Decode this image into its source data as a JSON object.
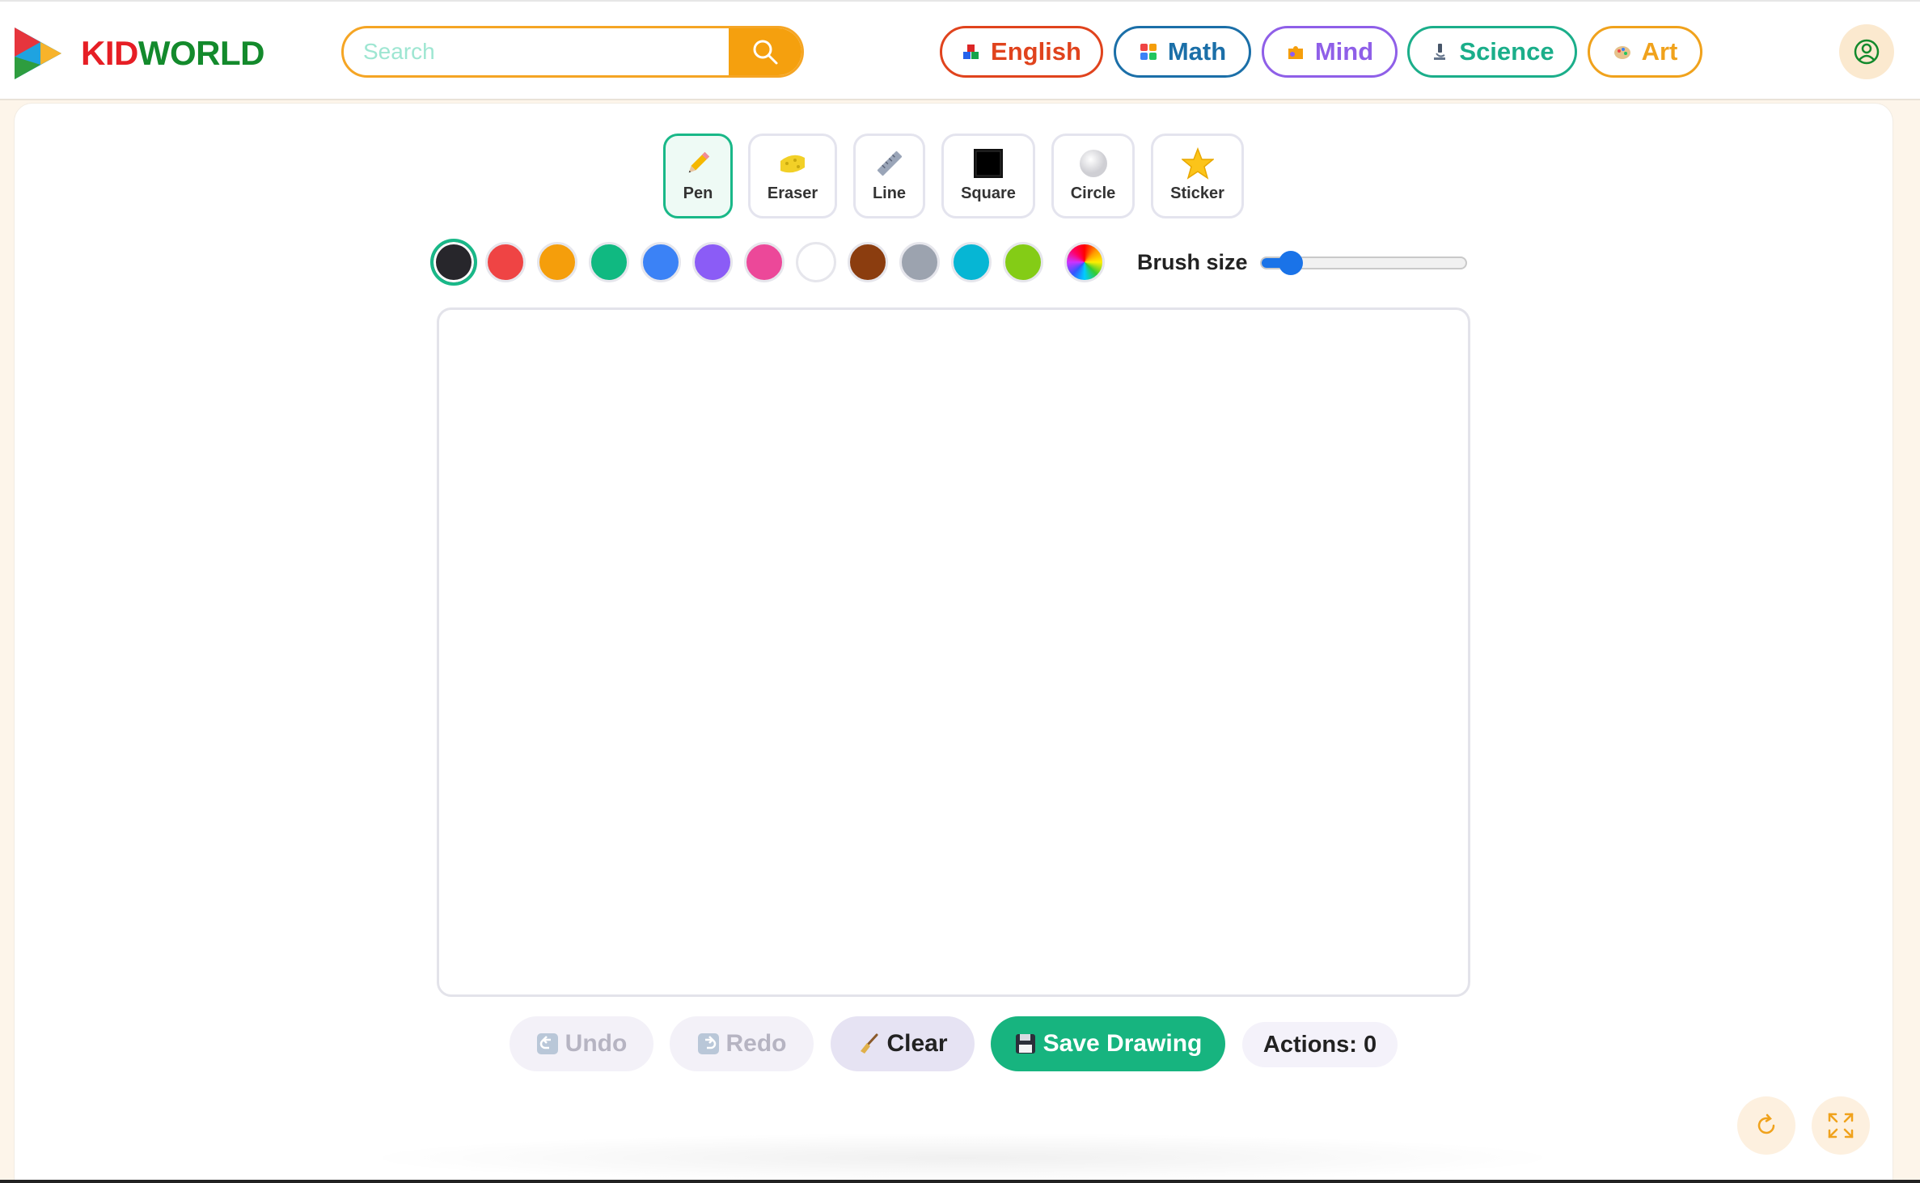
{
  "header": {
    "brand_part1": "KID",
    "brand_part2": "WORLD",
    "search_placeholder": "Search",
    "nav": [
      {
        "label": "English",
        "color": "#e0431d"
      },
      {
        "label": "Math",
        "color": "#1b6fa8"
      },
      {
        "label": "Mind",
        "color": "#8f5fe8"
      },
      {
        "label": "Science",
        "color": "#1bae8a"
      },
      {
        "label": "Art",
        "color": "#f0a21c"
      }
    ]
  },
  "tools": [
    {
      "label": "Pen",
      "icon": "pencil-icon",
      "active": true
    },
    {
      "label": "Eraser",
      "icon": "sponge-icon",
      "active": false
    },
    {
      "label": "Line",
      "icon": "ruler-icon",
      "active": false
    },
    {
      "label": "Square",
      "icon": "square-icon",
      "active": false
    },
    {
      "label": "Circle",
      "icon": "circle-icon",
      "active": false
    },
    {
      "label": "Sticker",
      "icon": "star-icon",
      "active": false
    }
  ],
  "palette": {
    "colors": [
      "#27262b",
      "#ef4444",
      "#f59e0b",
      "#10b981",
      "#3b82f6",
      "#8b5cf6",
      "#ec4899",
      "#ffffff",
      "#8b3d0f",
      "#9ca3af",
      "#06b6d4",
      "#84cc16"
    ],
    "selected_index": 0
  },
  "brush": {
    "label": "Brush size",
    "value_fraction": 0.08
  },
  "actions": {
    "undo": "Undo",
    "redo": "Redo",
    "clear": "Clear",
    "save": "Save Drawing",
    "count": "Actions: 0"
  },
  "colors": {
    "accent_green": "#17b47f",
    "search_orange": "#f5a00e"
  }
}
